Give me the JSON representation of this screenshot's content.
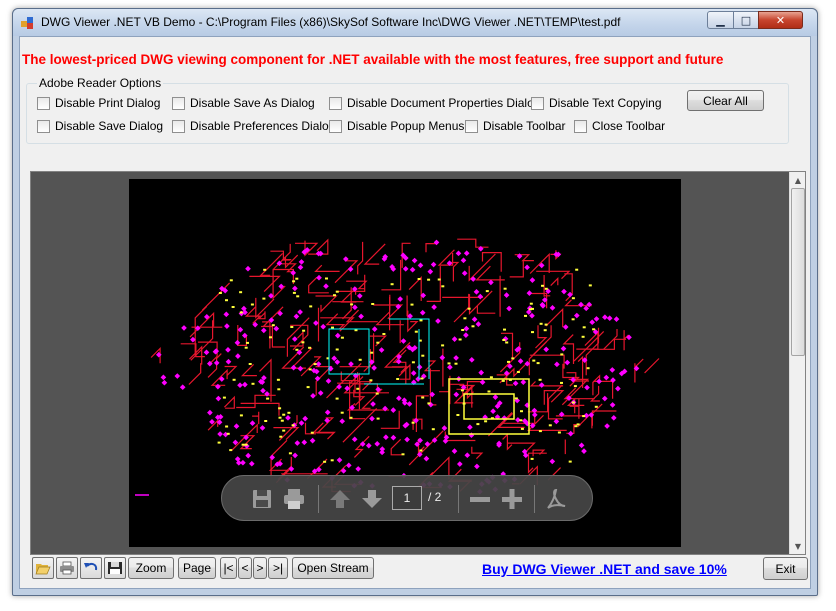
{
  "window": {
    "title": "DWG Viewer .NET VB Demo  - C:\\Program Files (x86)\\SkySof Software Inc\\DWG Viewer .NET\\TEMP\\test.pdf",
    "caption_minimize": "▁",
    "caption_maximize": "□",
    "caption_close": "✕"
  },
  "banner": {
    "text": "The lowest-priced DWG viewing component for .NET available with the most features, free support and future",
    "color": "#ff0000"
  },
  "options": {
    "group_label": "Adobe Reader Options",
    "row1": [
      "Disable Print Dialog",
      "Disable Save As Dialog",
      "Disable Document Properties Dialog",
      "Disable Text Copying"
    ],
    "row2": [
      "Disable Save Dialog",
      "Disable Preferences Dialog",
      "Disable Popup Menus",
      "Disable Toolbar",
      "Close Toolbar"
    ],
    "clear_all_label": "Clear All"
  },
  "pdf_toolbar": {
    "icons": [
      "save-icon",
      "print-icon",
      "page-up-icon",
      "page-down-icon",
      "zoom-out-icon",
      "zoom-in-icon",
      "acrobat-icon"
    ],
    "current_page": "1",
    "total_pages": "/ 2"
  },
  "bottom_bar": {
    "icon_buttons": [
      "open-folder-icon",
      "print-icon",
      "undo-icon",
      "save-icon"
    ],
    "zoom_label": "Zoom",
    "page_label": "Page",
    "first_label": "|<",
    "prev_label": "<",
    "next_label": ">",
    "last_label": ">|",
    "open_stream_label": "Open Stream",
    "buy_link": "Buy DWG Viewer .NET and save 10%",
    "exit_label": "Exit"
  },
  "colors": {
    "cad_red": "#e6162d",
    "cad_magenta": "#ff00ff",
    "cad_yellow": "#ffff3c",
    "cad_cyan": "#00ffff",
    "link_blue": "#0000ff"
  }
}
